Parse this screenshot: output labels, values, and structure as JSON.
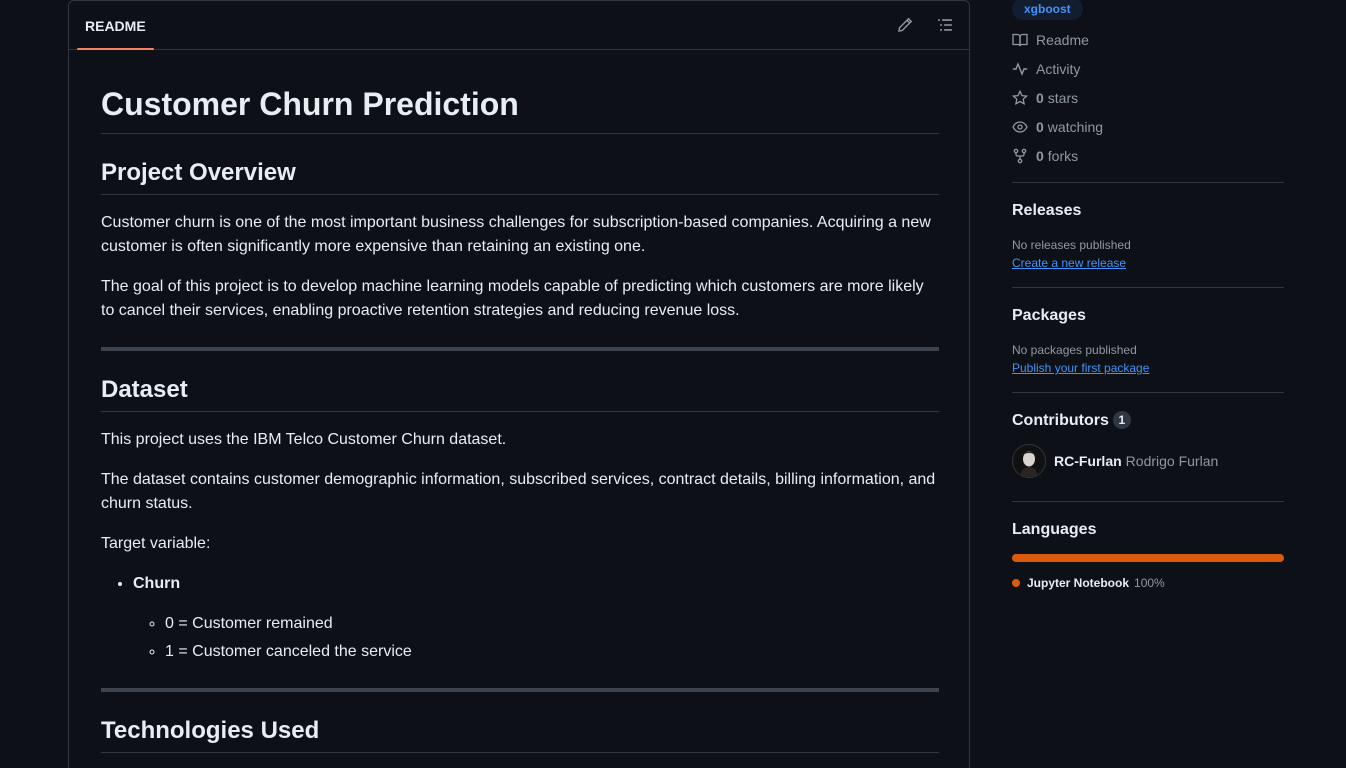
{
  "readme": {
    "tab_label": "README",
    "title": "Customer Churn Prediction",
    "sections": {
      "overview_heading": "Project Overview",
      "overview_p1": "Customer churn is one of the most important business challenges for subscription-based companies. Acquiring a new customer is often significantly more expensive than retaining an existing one.",
      "overview_p2": "The goal of this project is to develop machine learning models capable of predicting which customers are more likely to cancel their services, enabling proactive retention strategies and reducing revenue loss.",
      "dataset_heading": "Dataset",
      "dataset_p1": "This project uses the IBM Telco Customer Churn dataset.",
      "dataset_p2": "The dataset contains customer demographic information, subscribed services, contract details, billing information, and churn status.",
      "target_label": "Target variable:",
      "target_item": "Churn",
      "target_sub": [
        "0 = Customer remained",
        "1 = Customer canceled the service"
      ],
      "tech_heading": "Technologies Used"
    }
  },
  "sidebar": {
    "topic": "xgboost",
    "meta": [
      {
        "icon": "book-icon",
        "count": "",
        "label": "Readme"
      },
      {
        "icon": "pulse-icon",
        "count": "",
        "label": "Activity"
      },
      {
        "icon": "star-icon",
        "count": "0",
        "label": "stars"
      },
      {
        "icon": "eye-icon",
        "count": "0",
        "label": "watching"
      },
      {
        "icon": "fork-icon",
        "count": "0",
        "label": "forks"
      }
    ],
    "releases": {
      "heading": "Releases",
      "note": "No releases published",
      "link": "Create a new release"
    },
    "packages": {
      "heading": "Packages",
      "note": "No packages published",
      "link": "Publish your first package"
    },
    "contributors": {
      "heading": "Contributors",
      "count": "1",
      "login": "RC-Furlan",
      "name": "Rodrigo Furlan"
    },
    "languages": {
      "heading": "Languages",
      "items": [
        {
          "name": "Jupyter Notebook",
          "percent": "100%",
          "color": "#da5b0b",
          "fraction": 1.0
        }
      ]
    }
  }
}
